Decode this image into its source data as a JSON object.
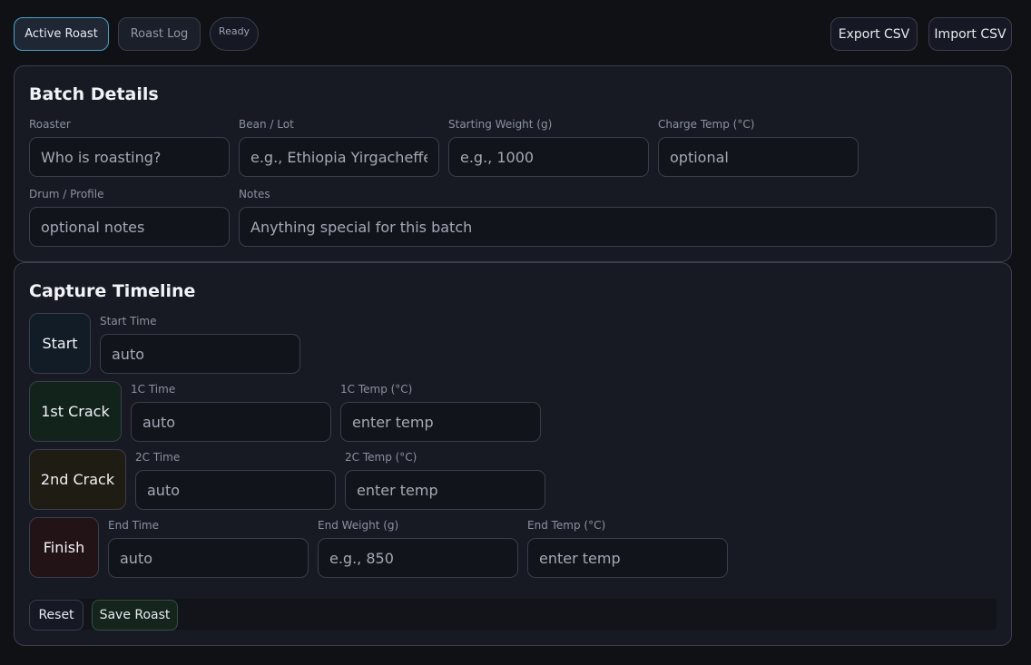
{
  "tabs": {
    "active_roast": "Active Roast",
    "roast_log": "Roast Log"
  },
  "status": "Ready",
  "toolbar": {
    "export_csv": "Export CSV",
    "import_csv": "Import CSV"
  },
  "batch": {
    "title": "Batch Details",
    "roaster": {
      "label": "Roaster",
      "placeholder": "Who is roasting?"
    },
    "bean": {
      "label": "Bean / Lot",
      "placeholder": "e.g., Ethiopia Yirgacheffe"
    },
    "start_weight": {
      "label": "Starting Weight (g)",
      "placeholder": "e.g., 1000"
    },
    "charge_temp": {
      "label": "Charge Temp (°C)",
      "placeholder": "optional"
    },
    "drum": {
      "label": "Drum / Profile",
      "placeholder": "optional notes"
    },
    "notes": {
      "label": "Notes",
      "placeholder": "Anything special for this batch"
    }
  },
  "timeline": {
    "title": "Capture Timeline",
    "start": {
      "button": "Start",
      "time_label": "Start Time",
      "time_placeholder": "auto"
    },
    "first_crack": {
      "button": "1st Crack",
      "time_label": "1C Time",
      "time_placeholder": "auto",
      "temp_label": "1C Temp (°C)",
      "temp_placeholder": "enter temp"
    },
    "second_crack": {
      "button": "2nd Crack",
      "time_label": "2C Time",
      "time_placeholder": "auto",
      "temp_label": "2C Temp (°C)",
      "temp_placeholder": "enter temp"
    },
    "finish": {
      "button": "Finish",
      "time_label": "End Time",
      "time_placeholder": "auto",
      "weight_label": "End Weight (g)",
      "weight_placeholder": "e.g., 850",
      "temp_label": "End Temp (°C)",
      "temp_placeholder": "enter temp"
    }
  },
  "actions": {
    "reset": "Reset",
    "save": "Save Roast"
  },
  "colors": {
    "accent": "#4aa0c8",
    "background": "#101114",
    "panel": "#181a23"
  }
}
